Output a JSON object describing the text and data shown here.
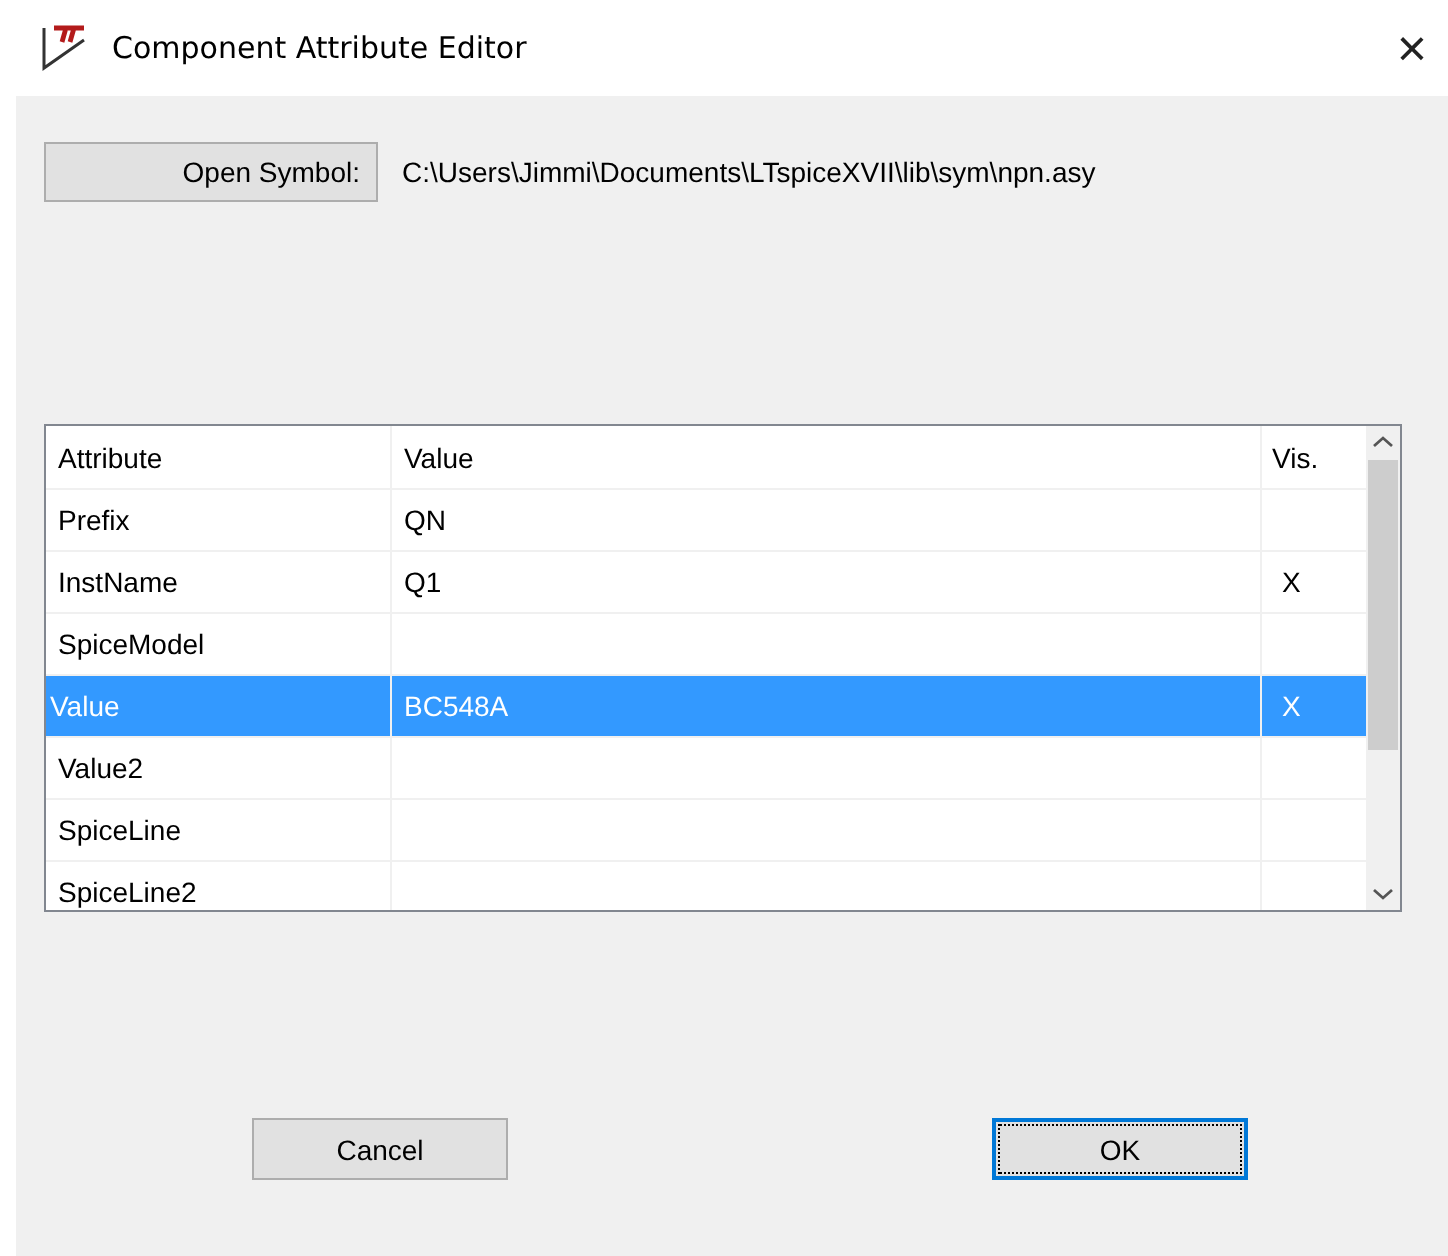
{
  "window": {
    "title": "Component Attribute Editor",
    "close": "×"
  },
  "open_symbol": {
    "button": "Open Symbol:",
    "path": "C:\\Users\\Jimmi\\Documents\\LTspiceXVII\\lib\\sym\\npn.asy"
  },
  "table": {
    "columns": [
      "Attribute",
      "Value",
      "Vis."
    ],
    "rows": [
      {
        "attribute": "Prefix",
        "value": "QN",
        "vis": "",
        "selected": false
      },
      {
        "attribute": "InstName",
        "value": "Q1",
        "vis": "X",
        "selected": false
      },
      {
        "attribute": "SpiceModel",
        "value": "",
        "vis": "",
        "selected": false
      },
      {
        "attribute": "Value",
        "value": "BC548A",
        "vis": "X",
        "selected": true
      },
      {
        "attribute": "Value2",
        "value": "",
        "vis": "",
        "selected": false
      },
      {
        "attribute": "SpiceLine",
        "value": "",
        "vis": "",
        "selected": false
      },
      {
        "attribute": "SpiceLine2",
        "value": "",
        "vis": "",
        "selected": false
      }
    ]
  },
  "buttons": [
    {
      "label": "Cancel",
      "default": false
    },
    {
      "label": "OK",
      "default": true
    }
  ]
}
